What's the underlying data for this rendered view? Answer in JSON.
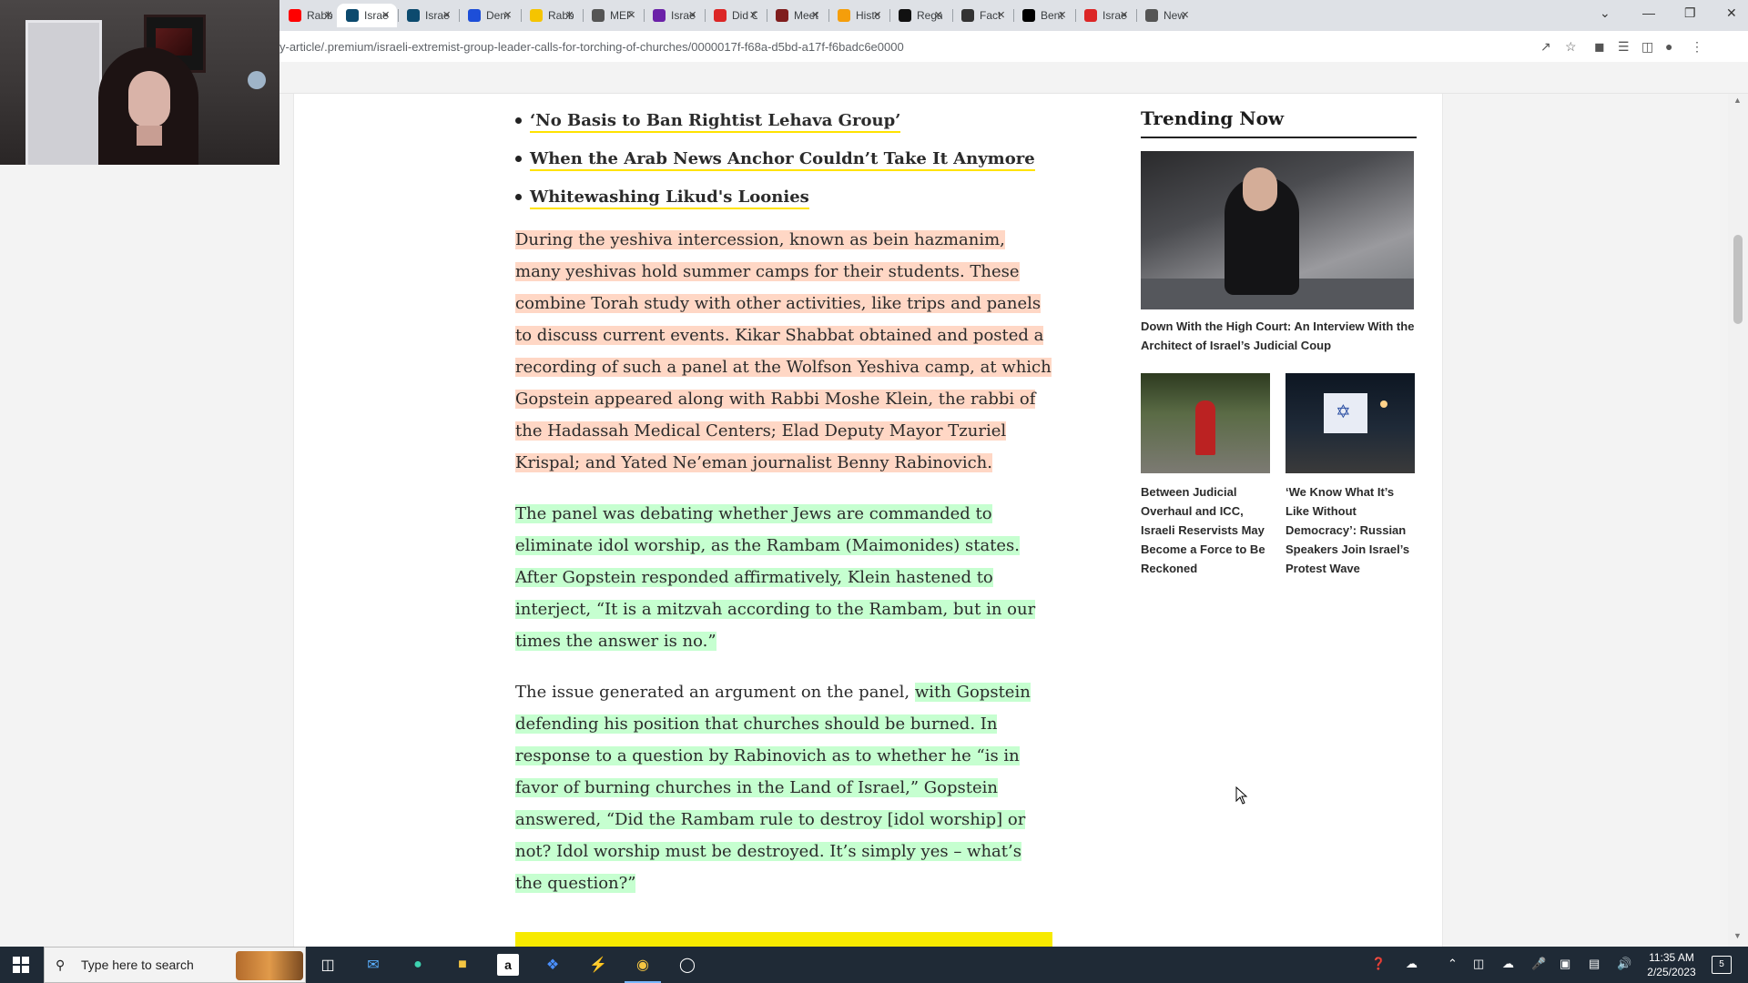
{
  "browser": {
    "tabs": [
      {
        "label": "Rabb",
        "icon": "youtube-icon",
        "color": "#ff0000"
      },
      {
        "label": "Israe",
        "icon": "haaretz-icon",
        "color": "#0c4a6e",
        "active": true
      },
      {
        "label": "Israe",
        "icon": "haaretz-icon",
        "color": "#0c4a6e"
      },
      {
        "label": "Dem",
        "icon": "news-icon",
        "color": "#1d4ed8"
      },
      {
        "label": "Rabb",
        "icon": "play-icon",
        "color": "#f5c400"
      },
      {
        "label": "MEF",
        "icon": "globe-icon",
        "color": "#555555"
      },
      {
        "label": "Israe",
        "icon": "circle-icon",
        "color": "#6b21a8"
      },
      {
        "label": "Did C",
        "icon": "plus-icon",
        "color": "#dc2626"
      },
      {
        "label": "Meet",
        "icon": "book-icon",
        "color": "#7f1d1d"
      },
      {
        "label": "Histc",
        "icon": "flame-icon",
        "color": "#f59e0b"
      },
      {
        "label": "Rega",
        "icon": "brand-icon",
        "color": "#111111"
      },
      {
        "label": "Fact",
        "icon": "brand-icon",
        "color": "#333333"
      },
      {
        "label": "Bent",
        "icon": "wikipedia-icon",
        "color": "#000000"
      },
      {
        "label": "Israe",
        "icon": "shield-icon",
        "color": "#dc2626"
      },
      {
        "label": "New",
        "icon": "globe-icon",
        "color": "#555555"
      }
    ],
    "new_tab": "+",
    "url": "y-article/.premium/israeli-extremist-group-leader-calls-for-torching-of-churches/0000017f-f68a-d5bd-a17f-f6badc6e0000"
  },
  "article": {
    "related_links": [
      "‘No Basis to Ban Rightist Lehava Group’",
      "When the Arab News Anchor Couldn’t Take It Anymore",
      "Whitewashing Likud's Loonies"
    ],
    "p1": "During the yeshiva intercession, known as bein hazmanim, many yeshivas hold summer camps for their students. These combine Torah study with other activities, like trips and panels to discuss current events. Kikar Shabbat obtained and posted a recording of such a panel at the Wolfson Yeshiva camp, at which Gopstein appeared along with Rabbi Moshe Klein, the rabbi of the Hadassah Medical Centers; Elad Deputy Mayor Tzuriel Krispal; and Yated Ne’eman journalist Benny Rabinovich.",
    "p2": "The panel was debating whether Jews are commanded to eliminate idol worship, as the Rambam (Maimonides) states. After Gopstein responded affirmatively, Klein hastened to interject, “It is a mitzvah according to the Rambam, but in our times the answer is no.”",
    "p3_plain": "The issue generated an argument on the panel, ",
    "p3_highlight": "with Gopstein defending his position that churches should be burned. In response to a question by Rabinovich as to whether he “is in favor of burning churches in the Land of Israel,” Gopstein answered, “Did the Rambam rule to destroy [idol worship] or not? Idol worship must be destroyed. It’s simply yes – what’s the question?”"
  },
  "trending": {
    "title": "Trending Now",
    "main_caption": "Down With the High Court: An Interview With the Architect of Israel’s Judicial Coup",
    "card1_caption": "Between Judicial Overhaul and ICC, Israeli Reservists May Become a Force to Be Reckoned",
    "card2_caption": "‘We Know What It’s Like Without Democracy’: Russian Speakers Join Israel’s Protest Wave"
  },
  "taskbar": {
    "search_placeholder": "Type here to search",
    "time": "11:35 AM",
    "date": "2/25/2023",
    "notifications": "5"
  },
  "colors": {
    "highlight_orange": "#ffd7c5",
    "highlight_green": "#c6ffd0",
    "link_underline": "#ffe300"
  }
}
